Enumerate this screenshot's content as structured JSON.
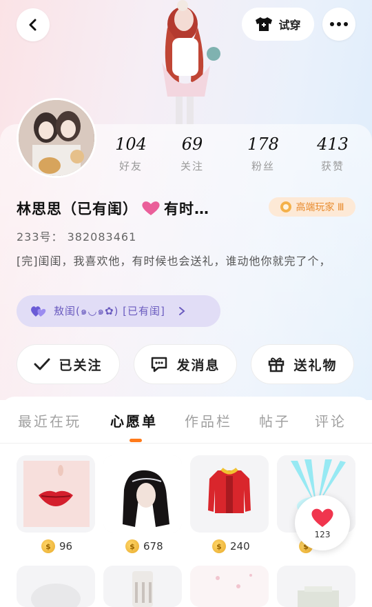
{
  "header": {
    "tryon_label": "试穿"
  },
  "stats": [
    {
      "value": "104",
      "label": "好友"
    },
    {
      "value": "69",
      "label": "关注"
    },
    {
      "value": "178",
      "label": "粉丝"
    },
    {
      "value": "413",
      "label": "获赞"
    }
  ],
  "profile": {
    "name_part1": "林思思（已有闺）",
    "name_part2": "有时…",
    "level_badge": "高端玩家 Ⅲ",
    "uid": "233号： 382083461",
    "bio": "[完]闺闺，我喜欢他，有时候也会送礼，谁动他你就完了个，",
    "cp_label": "敖闺(๑◡๑✿) [已有闺]"
  },
  "actions": {
    "follow": "已关注",
    "message": "发消息",
    "gift": "送礼物"
  },
  "tabs": [
    "最近在玩",
    "心愿单",
    "作品栏",
    "帖子",
    "评论"
  ],
  "wishlist": [
    {
      "price": "96"
    },
    {
      "price": "678"
    },
    {
      "price": "240"
    },
    {
      "price": "-"
    }
  ],
  "like_fab": {
    "count": "123"
  },
  "colors": {
    "accent": "#ff7a1a",
    "badge_bg": "#fde9d6",
    "cp_bg": "#e1ddf6",
    "heart": "#f0356a"
  }
}
